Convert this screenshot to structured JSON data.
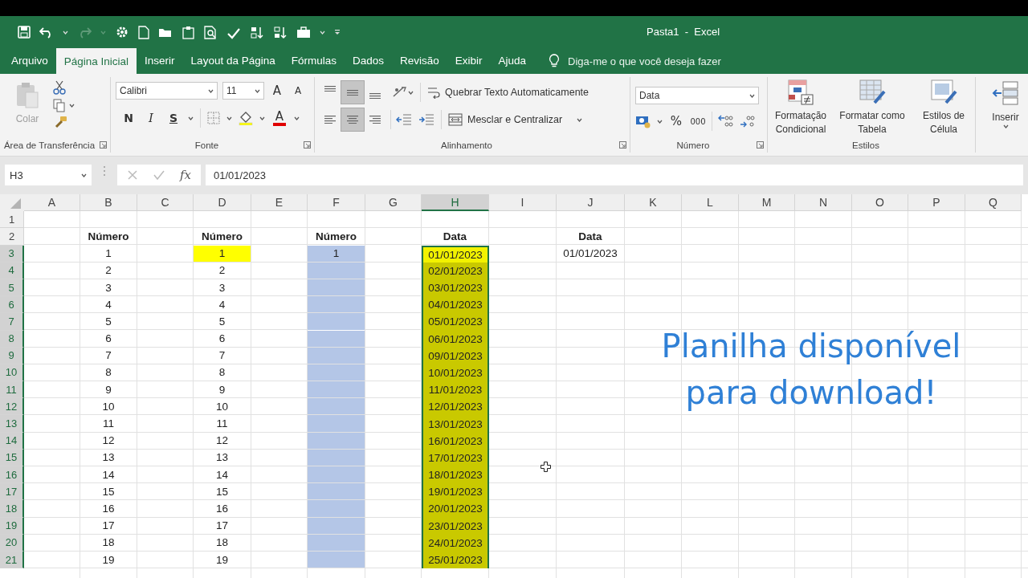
{
  "window": {
    "title": "Pasta1  -  Excel"
  },
  "tabs": [
    {
      "label": "Arquivo",
      "selected": false
    },
    {
      "label": "Página Inicial",
      "selected": true
    },
    {
      "label": "Inserir",
      "selected": false
    },
    {
      "label": "Layout da Página",
      "selected": false
    },
    {
      "label": "Fórmulas",
      "selected": false
    },
    {
      "label": "Dados",
      "selected": false
    },
    {
      "label": "Revisão",
      "selected": false
    },
    {
      "label": "Exibir",
      "selected": false
    },
    {
      "label": "Ajuda",
      "selected": false
    }
  ],
  "tell_me": {
    "placeholder": "Diga-me o que você deseja fazer"
  },
  "ribbon": {
    "clipboard": {
      "label": "Área de Transferência",
      "paste": "Colar"
    },
    "font": {
      "label": "Fonte",
      "font_name": "Calibri",
      "font_size": "11",
      "grow": "A",
      "shrink": "A",
      "bold": "N",
      "italic": "I",
      "underline": "S",
      "font_color": "A"
    },
    "alignment": {
      "label": "Alinhamento",
      "vertical": [
        {
          "pressed": false
        },
        {
          "pressed": true
        },
        {
          "pressed": false
        }
      ],
      "horizontal": [
        {
          "pressed": false
        },
        {
          "pressed": true
        },
        {
          "pressed": false
        }
      ],
      "wrap": "Quebrar Texto Automaticamente",
      "merge": "Mesclar e Centralizar"
    },
    "number": {
      "label": "Número",
      "format": "Data",
      "percent": "%",
      "thousands": "000"
    },
    "styles": {
      "label": "Estilos",
      "buttons": [
        {
          "kind": "conditional",
          "label": "Formatação Condicional"
        },
        {
          "kind": "table",
          "label": "Formatar como Tabela"
        },
        {
          "kind": "cell",
          "label": "Estilos de Célula"
        }
      ]
    },
    "cells": {
      "insert": "Inserir"
    }
  },
  "formula_bar": {
    "name_box": "H3",
    "function_label": "fx",
    "formula": "01/01/2023"
  },
  "sheet": {
    "columns": [
      {
        "label": "A",
        "selected": false
      },
      {
        "label": "B",
        "selected": false
      },
      {
        "label": "C",
        "selected": false
      },
      {
        "label": "D",
        "selected": false
      },
      {
        "label": "E",
        "selected": false
      },
      {
        "label": "F",
        "selected": false
      },
      {
        "label": "G",
        "selected": false
      },
      {
        "label": "H",
        "selected": true
      },
      {
        "label": "I",
        "selected": false
      },
      {
        "label": "J",
        "selected": false
      },
      {
        "label": "K",
        "selected": false
      },
      {
        "label": "L",
        "selected": false
      },
      {
        "label": "M",
        "selected": false
      },
      {
        "label": "N",
        "selected": false
      },
      {
        "label": "O",
        "selected": false
      },
      {
        "label": "P",
        "selected": false
      },
      {
        "label": "Q",
        "selected": false
      }
    ],
    "rows": [
      {
        "label": "1",
        "selected": false,
        "cells": []
      },
      {
        "label": "2",
        "selected": false,
        "cells": [
          null,
          {
            "text": "Número",
            "bold": true
          },
          null,
          {
            "text": "Número",
            "bold": true
          },
          null,
          {
            "text": "Número",
            "bold": true
          },
          null,
          {
            "text": "Data",
            "bold": true
          },
          null,
          {
            "text": "Data",
            "bold": true
          }
        ]
      },
      {
        "label": "3",
        "selected": true,
        "cells": [
          null,
          {
            "text": "1",
            "bold": false
          },
          null,
          {
            "text": "1",
            "bold": false,
            "color": "#ffff00"
          },
          null,
          {
            "text": "1",
            "bold": false,
            "color": "#b4c6e7"
          },
          null,
          {
            "text": "01/01/2023",
            "bold": false,
            "color": "#f2f200"
          },
          null,
          {
            "text": "01/01/2023",
            "bold": false
          }
        ]
      },
      {
        "label": "4",
        "selected": true,
        "cells": [
          null,
          {
            "text": "2",
            "bold": false
          },
          null,
          {
            "text": "2",
            "bold": false
          },
          null,
          {
            "color": "#b4c6e7"
          },
          null,
          {
            "text": "02/01/2023",
            "bold": false,
            "color": "#c9c900"
          }
        ]
      },
      {
        "label": "5",
        "selected": true,
        "cells": [
          null,
          {
            "text": "3",
            "bold": false
          },
          null,
          {
            "text": "3",
            "bold": false
          },
          null,
          {
            "color": "#b4c6e7"
          },
          null,
          {
            "text": "03/01/2023",
            "bold": false,
            "color": "#c9c900"
          }
        ]
      },
      {
        "label": "6",
        "selected": true,
        "cells": [
          null,
          {
            "text": "4",
            "bold": false
          },
          null,
          {
            "text": "4",
            "bold": false
          },
          null,
          {
            "color": "#b4c6e7"
          },
          null,
          {
            "text": "04/01/2023",
            "bold": false,
            "color": "#c9c900"
          }
        ]
      },
      {
        "label": "7",
        "selected": true,
        "cells": [
          null,
          {
            "text": "5",
            "bold": false
          },
          null,
          {
            "text": "5",
            "bold": false
          },
          null,
          {
            "color": "#b4c6e7"
          },
          null,
          {
            "text": "05/01/2023",
            "bold": false,
            "color": "#c9c900"
          }
        ]
      },
      {
        "label": "8",
        "selected": true,
        "cells": [
          null,
          {
            "text": "6",
            "bold": false
          },
          null,
          {
            "text": "6",
            "bold": false
          },
          null,
          {
            "color": "#b4c6e7"
          },
          null,
          {
            "text": "06/01/2023",
            "bold": false,
            "color": "#c9c900"
          }
        ]
      },
      {
        "label": "9",
        "selected": true,
        "cells": [
          null,
          {
            "text": "7",
            "bold": false
          },
          null,
          {
            "text": "7",
            "bold": false
          },
          null,
          {
            "color": "#b4c6e7"
          },
          null,
          {
            "text": "09/01/2023",
            "bold": false,
            "color": "#c9c900"
          }
        ]
      },
      {
        "label": "10",
        "selected": true,
        "cells": [
          null,
          {
            "text": "8",
            "bold": false
          },
          null,
          {
            "text": "8",
            "bold": false
          },
          null,
          {
            "color": "#b4c6e7"
          },
          null,
          {
            "text": "10/01/2023",
            "bold": false,
            "color": "#c9c900"
          }
        ]
      },
      {
        "label": "11",
        "selected": true,
        "cells": [
          null,
          {
            "text": "9",
            "bold": false
          },
          null,
          {
            "text": "9",
            "bold": false
          },
          null,
          {
            "color": "#b4c6e7"
          },
          null,
          {
            "text": "11/01/2023",
            "bold": false,
            "color": "#c9c900"
          }
        ]
      },
      {
        "label": "12",
        "selected": true,
        "cells": [
          null,
          {
            "text": "10",
            "bold": false
          },
          null,
          {
            "text": "10",
            "bold": false
          },
          null,
          {
            "color": "#b4c6e7"
          },
          null,
          {
            "text": "12/01/2023",
            "bold": false,
            "color": "#c9c900"
          }
        ]
      },
      {
        "label": "13",
        "selected": true,
        "cells": [
          null,
          {
            "text": "11",
            "bold": false
          },
          null,
          {
            "text": "11",
            "bold": false
          },
          null,
          {
            "color": "#b4c6e7"
          },
          null,
          {
            "text": "13/01/2023",
            "bold": false,
            "color": "#c9c900"
          }
        ]
      },
      {
        "label": "14",
        "selected": true,
        "cells": [
          null,
          {
            "text": "12",
            "bold": false
          },
          null,
          {
            "text": "12",
            "bold": false
          },
          null,
          {
            "color": "#b4c6e7"
          },
          null,
          {
            "text": "16/01/2023",
            "bold": false,
            "color": "#c9c900"
          }
        ]
      },
      {
        "label": "15",
        "selected": true,
        "cells": [
          null,
          {
            "text": "13",
            "bold": false
          },
          null,
          {
            "text": "13",
            "bold": false
          },
          null,
          {
            "color": "#b4c6e7"
          },
          null,
          {
            "text": "17/01/2023",
            "bold": false,
            "color": "#c9c900"
          }
        ]
      },
      {
        "label": "16",
        "selected": true,
        "cells": [
          null,
          {
            "text": "14",
            "bold": false
          },
          null,
          {
            "text": "14",
            "bold": false
          },
          null,
          {
            "color": "#b4c6e7"
          },
          null,
          {
            "text": "18/01/2023",
            "bold": false,
            "color": "#c9c900"
          }
        ]
      },
      {
        "label": "17",
        "selected": true,
        "cells": [
          null,
          {
            "text": "15",
            "bold": false
          },
          null,
          {
            "text": "15",
            "bold": false
          },
          null,
          {
            "color": "#b4c6e7"
          },
          null,
          {
            "text": "19/01/2023",
            "bold": false,
            "color": "#c9c900"
          }
        ]
      },
      {
        "label": "18",
        "selected": true,
        "cells": [
          null,
          {
            "text": "16",
            "bold": false
          },
          null,
          {
            "text": "16",
            "bold": false
          },
          null,
          {
            "color": "#b4c6e7"
          },
          null,
          {
            "text": "20/01/2023",
            "bold": false,
            "color": "#c9c900"
          }
        ]
      },
      {
        "label": "19",
        "selected": true,
        "cells": [
          null,
          {
            "text": "17",
            "bold": false
          },
          null,
          {
            "text": "17",
            "bold": false
          },
          null,
          {
            "color": "#b4c6e7"
          },
          null,
          {
            "text": "23/01/2023",
            "bold": false,
            "color": "#c9c900"
          }
        ]
      },
      {
        "label": "20",
        "selected": true,
        "cells": [
          null,
          {
            "text": "18",
            "bold": false
          },
          null,
          {
            "text": "18",
            "bold": false
          },
          null,
          {
            "color": "#b4c6e7"
          },
          null,
          {
            "text": "24/01/2023",
            "bold": false,
            "color": "#c9c900"
          }
        ]
      },
      {
        "label": "21",
        "selected": true,
        "cells": [
          null,
          {
            "text": "19",
            "bold": false
          },
          null,
          {
            "text": "19",
            "bold": false
          },
          null,
          {
            "color": "#b4c6e7"
          },
          null,
          {
            "text": "25/01/2023",
            "bold": false,
            "color": "#c9c900"
          }
        ]
      }
    ]
  },
  "overlay_text": "Planilha disponível para download!"
}
